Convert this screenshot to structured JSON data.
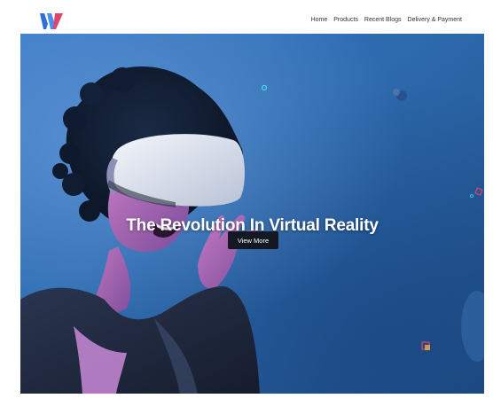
{
  "brand": {
    "logo_icon": "w-logo-icon",
    "colors": {
      "blue": "#2f6fd6",
      "pink": "#e0446c"
    }
  },
  "nav": {
    "items": [
      {
        "label": "Home"
      },
      {
        "label": "Products"
      },
      {
        "label": "Recent Blogs"
      },
      {
        "label": "Delivery & Payment"
      }
    ]
  },
  "hero": {
    "title": "The Revolution In Virtual Reality",
    "cta_label": "View More",
    "image_icon": "vr-headset-woman-photo"
  }
}
